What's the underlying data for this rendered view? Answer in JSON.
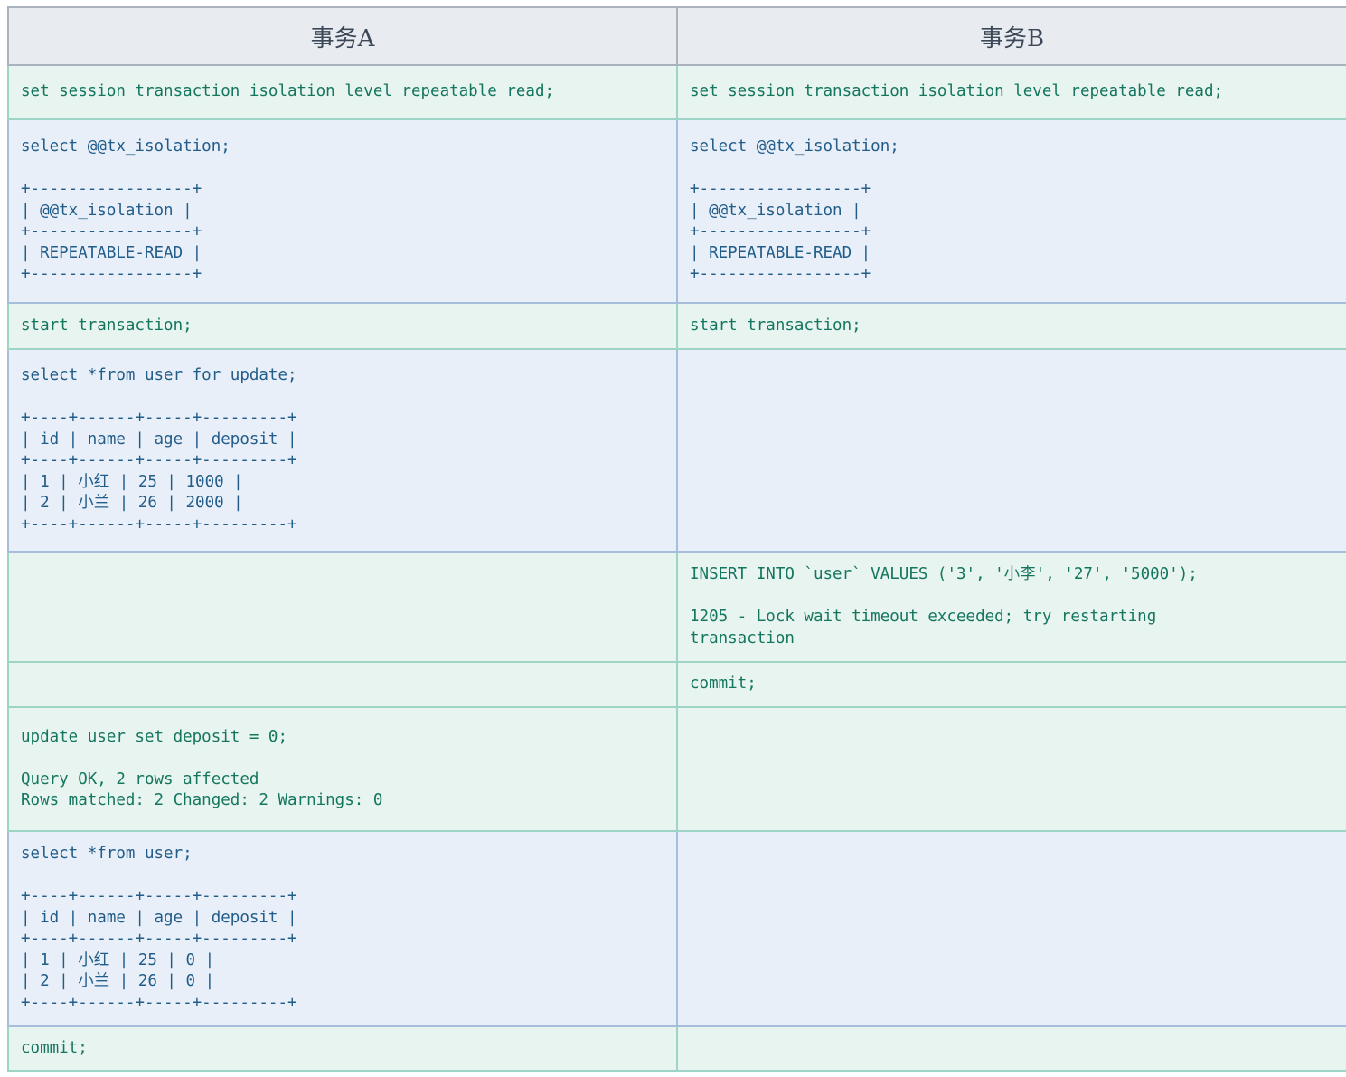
{
  "header": {
    "col_a": "事务A",
    "col_b": "事务B"
  },
  "rows": [
    {
      "a": "set session transaction isolation level repeatable read;",
      "b": "set session transaction isolation level repeatable read;"
    },
    {
      "a": "select @@tx_isolation;\n\n+-----------------+\n| @@tx_isolation |\n+-----------------+\n| REPEATABLE-READ |\n+-----------------+",
      "b": "select @@tx_isolation;\n\n+-----------------+\n| @@tx_isolation |\n+-----------------+\n| REPEATABLE-READ |\n+-----------------+"
    },
    {
      "a": "start transaction;",
      "b": "start transaction;"
    },
    {
      "a": "select *from user for update;\n\n+----+------+-----+---------+\n| id | name | age | deposit |\n+----+------+-----+---------+\n| 1 | 小红 | 25 | 1000 |\n| 2 | 小兰 | 26 | 2000 |\n+----+------+-----+---------+",
      "b": ""
    },
    {
      "a": "",
      "b": "INSERT INTO `user` VALUES ('3', '小李', '27', '5000');\n\n1205 - Lock wait timeout exceeded; try restarting\ntransaction"
    },
    {
      "a": "",
      "b": "commit;"
    },
    {
      "a": "update user set deposit = 0;\n\nQuery OK, 2 rows affected\nRows matched: 2 Changed: 2 Warnings: 0",
      "b": ""
    },
    {
      "a": "select *from user;\n\n+----+------+-----+---------+\n| id | name | age | deposit |\n+----+------+-----+---------+\n| 1 | 小红 | 25 | 0 |\n| 2 | 小兰 | 26 | 0 |\n+----+------+-----+---------+",
      "b": ""
    },
    {
      "a": "commit;",
      "b": ""
    }
  ]
}
